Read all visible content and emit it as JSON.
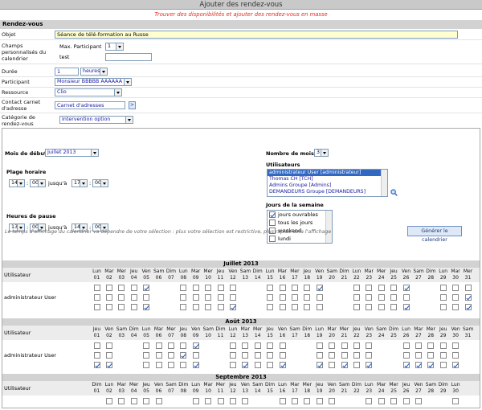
{
  "window": {
    "title": "Ajouter des rendez-vous"
  },
  "subtitle": "Trouver des disponibilités et ajouter des rendez-vous en masse",
  "section": "Rendez-vous",
  "form": {
    "objet": {
      "label": "Objet",
      "value": "Séance de télé-formation au Russe"
    },
    "champs": {
      "label": "Champs personnalisés du calendrier",
      "max_label": "Max. Participant",
      "max_value": "1",
      "test_label": "test",
      "test_value": ""
    },
    "duree": {
      "label": "Durée",
      "value": "1",
      "unit": "heures"
    },
    "participant": {
      "label": "Participant",
      "value": "Monsieur BBBBB AAAAAA"
    },
    "ressource": {
      "label": "Ressource",
      "value": "Clio"
    },
    "contact": {
      "label": "Contact carnet d'adresse",
      "value": "Carnet d'adresses",
      "btn": ">"
    },
    "categorie": {
      "label": "Catégorie de rendez-vous",
      "value": "Intervention option"
    }
  },
  "planner": {
    "mois_debut": {
      "label": "Mois de début",
      "value": "Juillet 2013"
    },
    "nombre_mois": {
      "label": "Nombre de mois",
      "value": "3"
    },
    "plage": {
      "label": "Plage horaire",
      "h1": "14",
      "m1": "00",
      "jusqua": "jusqu'à",
      "h2": "17",
      "m2": "00"
    },
    "pause": {
      "label": "Heures de pause",
      "h1": "13",
      "m1": "00",
      "jusqua": "jusqu'à",
      "h2": "14",
      "m2": "00"
    },
    "utilisateurs": {
      "label": "Utilisateurs",
      "options": [
        "administrateur User [administrateur]",
        "Thomas CH [TCH]",
        "Admins Groupe [Admins]",
        "DEMANDEURS Groupe [DEMANDEURS]"
      ]
    },
    "jours": {
      "label": "Jours de la semaine",
      "options": [
        {
          "label": "jours ouvrables",
          "checked": true
        },
        {
          "label": "tous les jours",
          "checked": false
        },
        {
          "label": "weekend",
          "checked": false
        },
        {
          "label": "lundi",
          "checked": false
        }
      ]
    },
    "note": "Le temps d'affichage du calendrier va dépendre de votre sélection : plus votre sélection est restrictive, plus rapide sera l'affichage",
    "generate_btn": "Générer le calendrier"
  },
  "calendar": {
    "user_col": "Utilisateur",
    "months": [
      {
        "name": "Juillet 2013",
        "user": "administrateur User",
        "days": [
          [
            "Lun",
            "01"
          ],
          [
            "Mar",
            "02"
          ],
          [
            "Mer",
            "03"
          ],
          [
            "Jeu",
            "04"
          ],
          [
            "Ven",
            "05"
          ],
          [
            "Sam",
            "06"
          ],
          [
            "Dim",
            "07"
          ],
          [
            "Lun",
            "08"
          ],
          [
            "Mar",
            "09"
          ],
          [
            "Mer",
            "10"
          ],
          [
            "Jeu",
            "11"
          ],
          [
            "Ven",
            "12"
          ],
          [
            "Sam",
            "13"
          ],
          [
            "Dim",
            "14"
          ],
          [
            "Lun",
            "15"
          ],
          [
            "Mar",
            "16"
          ],
          [
            "Mer",
            "17"
          ],
          [
            "Jeu",
            "18"
          ],
          [
            "Ven",
            "19"
          ],
          [
            "Sam",
            "20"
          ],
          [
            "Dim",
            "21"
          ],
          [
            "Lun",
            "22"
          ],
          [
            "Mar",
            "23"
          ],
          [
            "Mer",
            "24"
          ],
          [
            "Jeu",
            "25"
          ],
          [
            "Ven",
            "26"
          ],
          [
            "Sam",
            "27"
          ],
          [
            "Dim",
            "28"
          ],
          [
            "Lun",
            "29"
          ],
          [
            "Mar",
            "30"
          ],
          [
            "Mer",
            "31"
          ]
        ],
        "rows": [
          [
            0,
            0,
            0,
            0,
            1,
            -1,
            -1,
            0,
            0,
            0,
            0,
            0,
            -1,
            -1,
            0,
            0,
            0,
            0,
            1,
            -1,
            -1,
            0,
            0,
            0,
            0,
            1,
            -1,
            -1,
            0,
            0,
            0
          ],
          [
            0,
            0,
            0,
            0,
            0,
            -1,
            -1,
            0,
            0,
            0,
            0,
            0,
            -1,
            -1,
            0,
            0,
            0,
            0,
            0,
            -1,
            -1,
            0,
            0,
            0,
            0,
            0,
            -1,
            -1,
            0,
            0,
            1
          ],
          [
            0,
            0,
            0,
            0,
            1,
            -1,
            -1,
            0,
            0,
            0,
            0,
            1,
            -1,
            -1,
            0,
            0,
            0,
            0,
            0,
            -1,
            -1,
            0,
            0,
            0,
            0,
            1,
            -1,
            -1,
            0,
            0,
            1
          ]
        ]
      },
      {
        "name": "Août 2013",
        "user": "administrateur User",
        "days": [
          [
            "Jeu",
            "01"
          ],
          [
            "Ven",
            "02"
          ],
          [
            "Sam",
            "03"
          ],
          [
            "Dim",
            "04"
          ],
          [
            "Lun",
            "05"
          ],
          [
            "Mar",
            "06"
          ],
          [
            "Mer",
            "07"
          ],
          [
            "Jeu",
            "08"
          ],
          [
            "Ven",
            "09"
          ],
          [
            "Sam",
            "10"
          ],
          [
            "Dim",
            "11"
          ],
          [
            "Lun",
            "12"
          ],
          [
            "Mar",
            "13"
          ],
          [
            "Mer",
            "14"
          ],
          [
            "Jeu",
            "15"
          ],
          [
            "Ven",
            "16"
          ],
          [
            "Sam",
            "17"
          ],
          [
            "Dim",
            "18"
          ],
          [
            "Lun",
            "19"
          ],
          [
            "Mar",
            "20"
          ],
          [
            "Mer",
            "21"
          ],
          [
            "Jeu",
            "22"
          ],
          [
            "Ven",
            "23"
          ],
          [
            "Sam",
            "24"
          ],
          [
            "Dim",
            "25"
          ],
          [
            "Lun",
            "26"
          ],
          [
            "Mar",
            "27"
          ],
          [
            "Mer",
            "28"
          ],
          [
            "Jeu",
            "29"
          ],
          [
            "Ven",
            "30"
          ],
          [
            "Sam",
            "31"
          ]
        ],
        "rows": [
          [
            0,
            0,
            -1,
            -1,
            0,
            0,
            0,
            0,
            1,
            -1,
            -1,
            0,
            0,
            0,
            0,
            0,
            -1,
            -1,
            0,
            0,
            0,
            0,
            0,
            -1,
            -1,
            0,
            0,
            0,
            0,
            0,
            -1
          ],
          [
            0,
            0,
            -1,
            -1,
            0,
            0,
            0,
            1,
            0,
            -1,
            -1,
            0,
            0,
            0,
            0,
            0,
            -1,
            -1,
            0,
            0,
            0,
            0,
            0,
            -1,
            -1,
            0,
            0,
            0,
            0,
            0,
            -1
          ],
          [
            1,
            1,
            -1,
            -1,
            0,
            0,
            0,
            0,
            1,
            -1,
            -1,
            0,
            1,
            0,
            0,
            1,
            -1,
            -1,
            1,
            0,
            1,
            0,
            1,
            -1,
            -1,
            1,
            1,
            1,
            0,
            1,
            -1
          ]
        ]
      },
      {
        "name": "Septembre 2013",
        "user": "",
        "days": [
          [
            "Dim",
            "01"
          ],
          [
            "Lun",
            "02"
          ],
          [
            "Mar",
            "03"
          ],
          [
            "Mer",
            "04"
          ],
          [
            "Jeu",
            "05"
          ],
          [
            "Ven",
            "06"
          ],
          [
            "Sam",
            "07"
          ],
          [
            "Dim",
            "08"
          ],
          [
            "Lun",
            "09"
          ],
          [
            "Mar",
            "10"
          ],
          [
            "Mer",
            "11"
          ],
          [
            "Jeu",
            "12"
          ],
          [
            "Ven",
            "13"
          ],
          [
            "Sam",
            "14"
          ],
          [
            "Dim",
            "15"
          ],
          [
            "Lun",
            "16"
          ],
          [
            "Mar",
            "17"
          ],
          [
            "Mer",
            "18"
          ],
          [
            "Jeu",
            "19"
          ],
          [
            "Ven",
            "20"
          ],
          [
            "Sam",
            "21"
          ],
          [
            "Dim",
            "22"
          ],
          [
            "Lun",
            "23"
          ],
          [
            "Mar",
            "24"
          ],
          [
            "Mer",
            "25"
          ],
          [
            "Jeu",
            "26"
          ],
          [
            "Ven",
            "27"
          ],
          [
            "Sam",
            "28"
          ],
          [
            "Dim",
            "29"
          ],
          [
            "Lun",
            "30"
          ]
        ],
        "rows": [
          [
            -1,
            0,
            0,
            0,
            0,
            0,
            -1,
            -1,
            0,
            0,
            0,
            0,
            0,
            -1,
            -1,
            0,
            0,
            0,
            0,
            0,
            -1,
            -1,
            0,
            0,
            0,
            0,
            0,
            -1,
            -1,
            0
          ]
        ]
      }
    ]
  }
}
